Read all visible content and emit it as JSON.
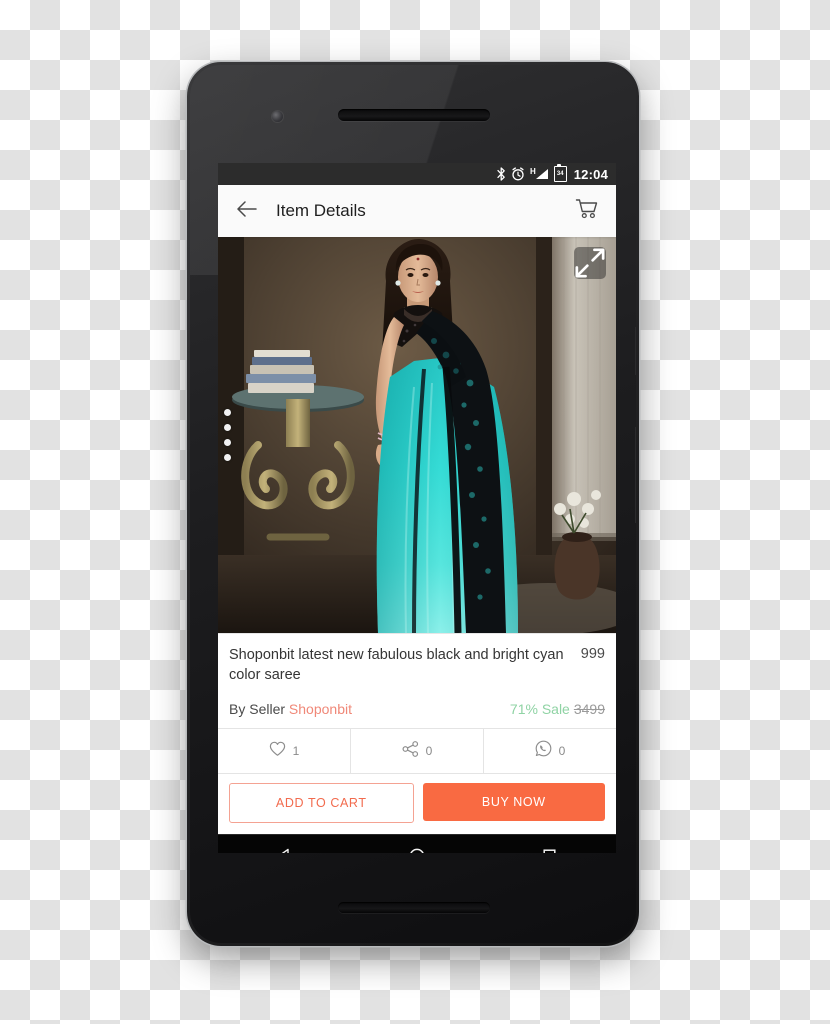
{
  "device": {
    "name": "android-smartphone-mockup",
    "body_color": "#1d1d1f",
    "frame_rim_color": "#b9bbbd"
  },
  "status_bar": {
    "icons": [
      "bluetooth-icon",
      "alarm-icon",
      "h-signal-icon",
      "battery-icon"
    ],
    "battery_level": "34",
    "network_type": "H",
    "time": "12:04",
    "background": "#2c2c2c"
  },
  "app_bar": {
    "back_icon": "arrow-left-icon",
    "title": "Item Details",
    "cart_icon": "shopping-cart-icon",
    "background": "#fafafa"
  },
  "hero": {
    "alt": "Model wearing black and bright cyan color saree in a studio setting",
    "expand_icon": "fullscreen-expand-icon",
    "carousel_dots": 4,
    "active_dot_index": 0,
    "palette": {
      "saree_cyan": "#2fd4cf",
      "saree_dark": "#12181c",
      "backdrop_brown": "#4a3d30",
      "curtain": "#cfcabf"
    }
  },
  "product": {
    "name": "Shoponbit latest new fabulous black and bright cyan color saree",
    "price": "999",
    "seller_prefix": "By Seller",
    "seller_name": "Shoponbit",
    "seller_color": "#f08878",
    "discount": "71% Sale",
    "discount_color": "#8fd3a4",
    "original_price": "3499"
  },
  "actions": [
    {
      "icon": "heart-icon",
      "name": "like-action",
      "count": "1"
    },
    {
      "icon": "share-icon",
      "name": "share-action",
      "count": "0"
    },
    {
      "icon": "whatsapp-icon",
      "name": "whatsapp-action",
      "count": "0"
    }
  ],
  "cta": {
    "add_to_cart": "ADD TO CART",
    "add_to_cart_color": "#f26b4e",
    "buy_now": "BUY NOW",
    "buy_now_bg": "#f96a42"
  },
  "nav_bar": {
    "back_icon": "nav-back-triangle-icon",
    "home_icon": "nav-home-circle-icon",
    "recents_icon": "nav-recents-square-icon",
    "background": "#050505"
  }
}
